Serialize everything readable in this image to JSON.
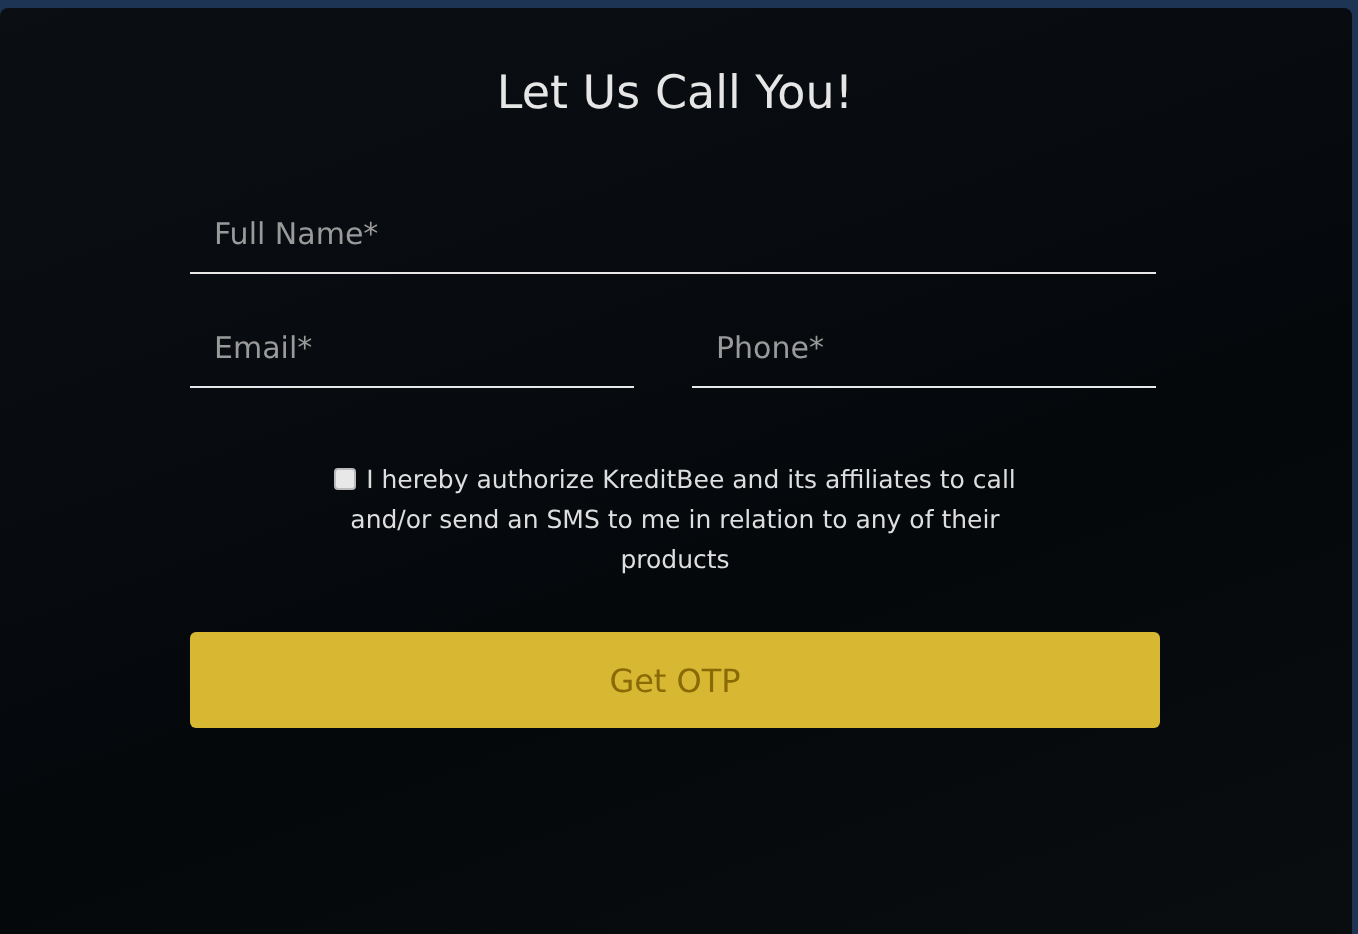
{
  "form": {
    "title": "Let Us Call You!",
    "fields": [
      {
        "placeholder": "Full Name*",
        "kind": "wide"
      },
      {
        "placeholder": "Email*",
        "kind": "narrow"
      },
      {
        "placeholder": "Phone*",
        "kind": "narrow"
      }
    ],
    "consent": {
      "checked": false,
      "text": "I hereby authorize KreditBee and its affiliates to call and/or send an SMS to me in relation to any of their products"
    },
    "submit": {
      "label": "Get OTP",
      "disabled": true
    }
  }
}
